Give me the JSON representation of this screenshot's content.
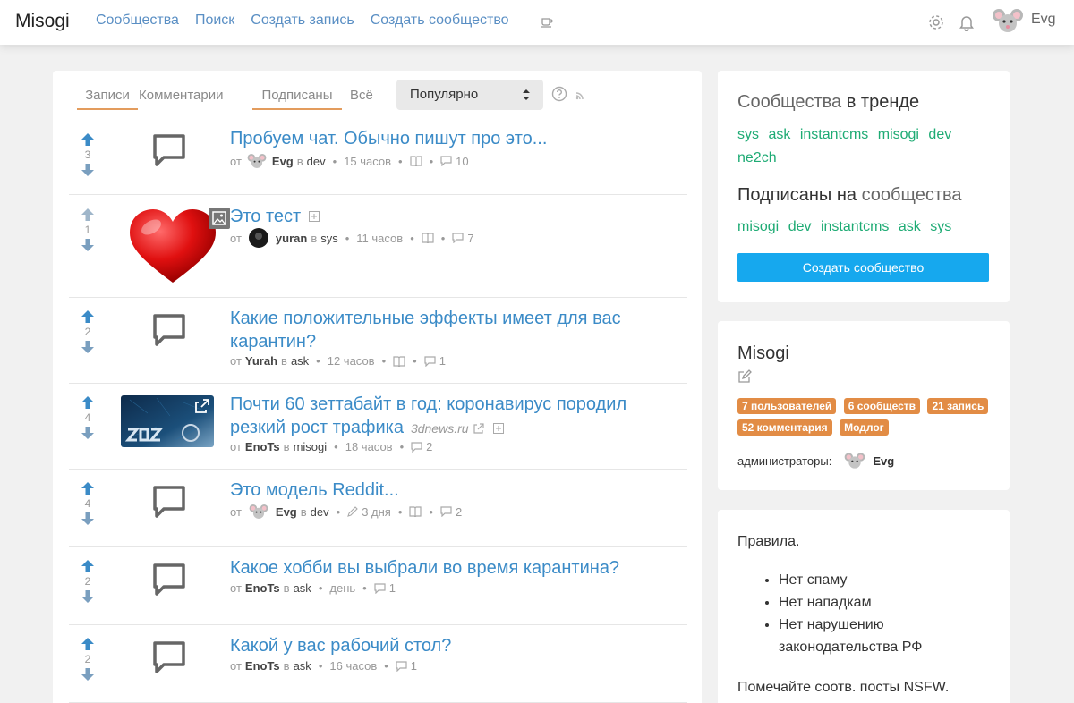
{
  "header": {
    "logo": "Misogi",
    "nav": [
      "Сообщества",
      "Поиск",
      "Создать запись",
      "Создать сообщество"
    ],
    "user": "Evg"
  },
  "feed": {
    "tabs": [
      "Записи",
      "Комментарии",
      "Подписаны",
      "Всё"
    ],
    "sort": "Популярно",
    "posts": [
      {
        "score": "3",
        "title": "Пробуем чат. Обычно пишут про это...",
        "from": "от",
        "author": "Evg",
        "in": "в",
        "community": "dev",
        "time": "15 часов",
        "comments": "10"
      },
      {
        "score": "1",
        "title": "Это тест",
        "from": "от",
        "author": "yuran",
        "in": "в",
        "community": "sys",
        "time": "11 часов",
        "comments": "7"
      },
      {
        "score": "2",
        "title": "Какие положительные эффекты имеет для вас карантин?",
        "from": "от",
        "author": "Yurah",
        "in": "в",
        "community": "ask",
        "time": "12 часов",
        "comments": "1"
      },
      {
        "score": "4",
        "title": "Почти 60 зеттабайт в год: коронавирус породил резкий рост трафика",
        "source": "3dnews.ru",
        "from": "от",
        "author": "EnoTs",
        "in": "в",
        "community": "misogi",
        "time": "18 часов",
        "comments": "2"
      },
      {
        "score": "4",
        "title": "Это модель Reddit...",
        "from": "от",
        "author": "Evg",
        "in": "в",
        "community": "dev",
        "time": "3 дня",
        "comments": "2"
      },
      {
        "score": "2",
        "title": "Какое хобби вы выбрали во время карантина?",
        "from": "от",
        "author": "EnoTs",
        "in": "в",
        "community": "ask",
        "time": "день",
        "comments": "1"
      },
      {
        "score": "2",
        "title": "Какой у вас рабочий стол?",
        "from": "от",
        "author": "EnoTs",
        "in": "в",
        "community": "ask",
        "time": "16 часов",
        "comments": "1"
      }
    ]
  },
  "sidebar": {
    "trending_title_a": "Сообщества",
    "trending_title_b": "в тренде",
    "trending": [
      "sys",
      "ask",
      "instantcms",
      "misogi",
      "dev",
      "ne2ch"
    ],
    "subscribed_title_a": "Подписаны на",
    "subscribed_title_b": "сообщества",
    "subscribed": [
      "misogi",
      "dev",
      "instantcms",
      "ask",
      "sys"
    ],
    "create_button": "Создать сообщество",
    "site_title": "Misogi",
    "badges": [
      "7 пользователей",
      "6 сообществ",
      "21 запись",
      "52 комментария",
      "Модлог"
    ],
    "admins_label": "администраторы:",
    "admin": "Evg",
    "rules_title": "Правила.",
    "rules": [
      "Нет спаму",
      "Нет нападкам",
      "Нет нарушению законодательства РФ"
    ],
    "rules_footer": "Помечайте соотв. посты NSFW."
  },
  "colors": {
    "accent_blue": "#3b8bc7",
    "accent_green": "#1eab74",
    "badge": "#e28c45",
    "button": "#16a8ee"
  }
}
